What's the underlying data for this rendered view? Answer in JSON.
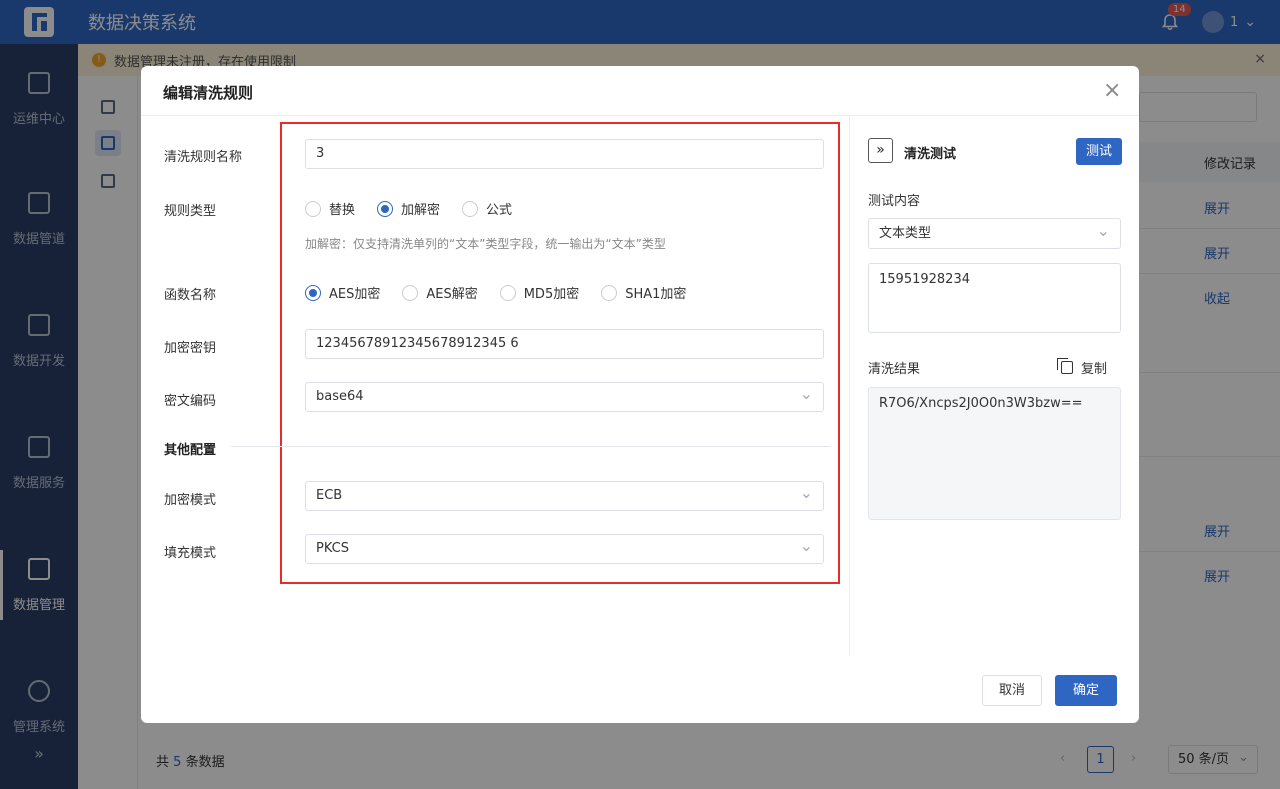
{
  "app": {
    "title": "数据决策系统",
    "notification_count": "14",
    "user_name": "1"
  },
  "sidebar": {
    "items": [
      {
        "label": "运维中心"
      },
      {
        "label": "数据管道"
      },
      {
        "label": "数据开发"
      },
      {
        "label": "数据服务"
      },
      {
        "label": "数据管理"
      },
      {
        "label": "管理系统"
      }
    ],
    "collapse": "»"
  },
  "notice": {
    "text": "数据管理未注册，存在使用限制",
    "close": "×"
  },
  "background_table": {
    "column_header": "修改记录",
    "row_links": [
      "展开",
      "展开",
      "收起",
      "展开",
      "展开"
    ]
  },
  "pagination": {
    "total_prefix": "共",
    "total_count": "5",
    "total_suffix": "条数据",
    "current_page": "1",
    "prev": "‹",
    "next": "›",
    "page_size": "50 条/页"
  },
  "modal": {
    "title": "编辑清洗规则",
    "close": "×",
    "form": {
      "name_label": "清洗规则名称",
      "name_value": "3",
      "rule_type_label": "规则类型",
      "rule_types": [
        "替换",
        "加解密",
        "公式"
      ],
      "rule_type_selected": "加解密",
      "rule_hint": "加解密：仅支持清洗单列的“文本”类型字段，统一输出为“文本”类型",
      "function_label": "函数名称",
      "functions": [
        "AES加密",
        "AES解密",
        "MD5加密",
        "SHA1加密"
      ],
      "function_selected": "AES加密",
      "key_label": "加密密钥",
      "key_value": "12345678912345678912345 6",
      "encoding_label": "密文编码",
      "encoding_value": "base64",
      "other_section": "其他配置",
      "mode_label": "加密模式",
      "mode_value": "ECB",
      "padding_label": "填充模式",
      "padding_value": "PKCS"
    },
    "test_panel": {
      "expand": "»",
      "title": "清洗测试",
      "test_button": "测试",
      "content_label": "测试内容",
      "content_type": "文本类型",
      "content_value": "15951928234",
      "result_label": "清洗结果",
      "copy_label": "复制",
      "result_value": "R7O6/Xncps2J0O0n3W3bzw=="
    },
    "cancel": "取消",
    "confirm": "确定"
  }
}
